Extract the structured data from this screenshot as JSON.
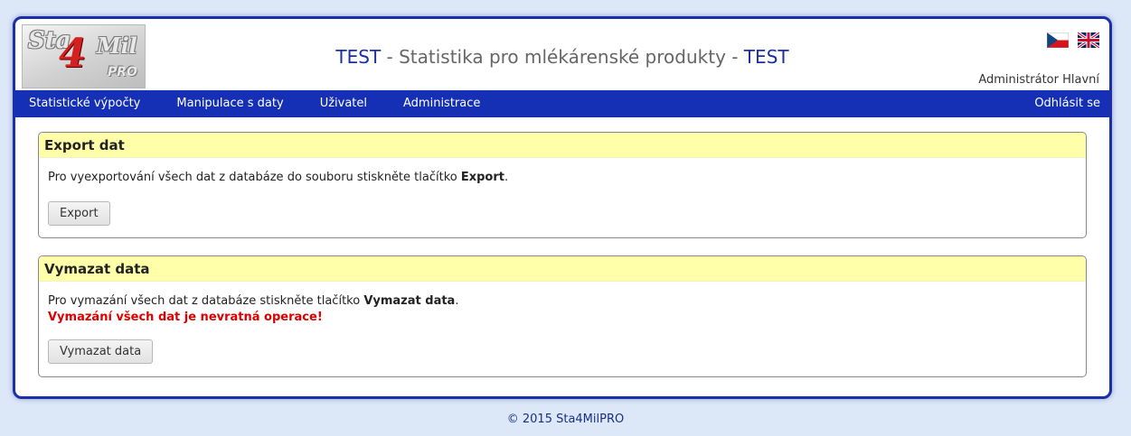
{
  "header": {
    "logo": {
      "sta": "Sta",
      "four": "4",
      "mil": "Mil",
      "pro": "PRO"
    },
    "title_env_left": "TEST",
    "title_main": " - Statistika pro mlékárenské produkty - ",
    "title_env_right": "TEST",
    "user_name": "Administrátor Hlavní",
    "flags": [
      "czech-flag-icon",
      "uk-flag-icon"
    ]
  },
  "nav": {
    "items": [
      "Statistické výpočty",
      "Manipulace s daty",
      "Uživatel",
      "Administrace"
    ],
    "logout": "Odhlásit se"
  },
  "export_panel": {
    "title": "Export dat",
    "text_before": "Pro vyexportování všech dat z databáze do souboru stiskněte tlačítko ",
    "text_bold": "Export",
    "text_after": ".",
    "button": "Export"
  },
  "delete_panel": {
    "title": "Vymazat data",
    "text_before": "Pro vymazání všech dat z databáze stiskněte tlačítko ",
    "text_bold": "Vymazat data",
    "text_after": ".",
    "warning": "Vymazání všech dat je nevratná operace!",
    "button": "Vymazat data"
  },
  "footer": {
    "text": "© 2015 Sta4MilPRO"
  },
  "colors": {
    "navbar": "#1530b5",
    "frame_border": "#1a2fa8",
    "panel_header": "#ffffaa",
    "warning": "#dd0000",
    "background": "#dce8f8"
  }
}
